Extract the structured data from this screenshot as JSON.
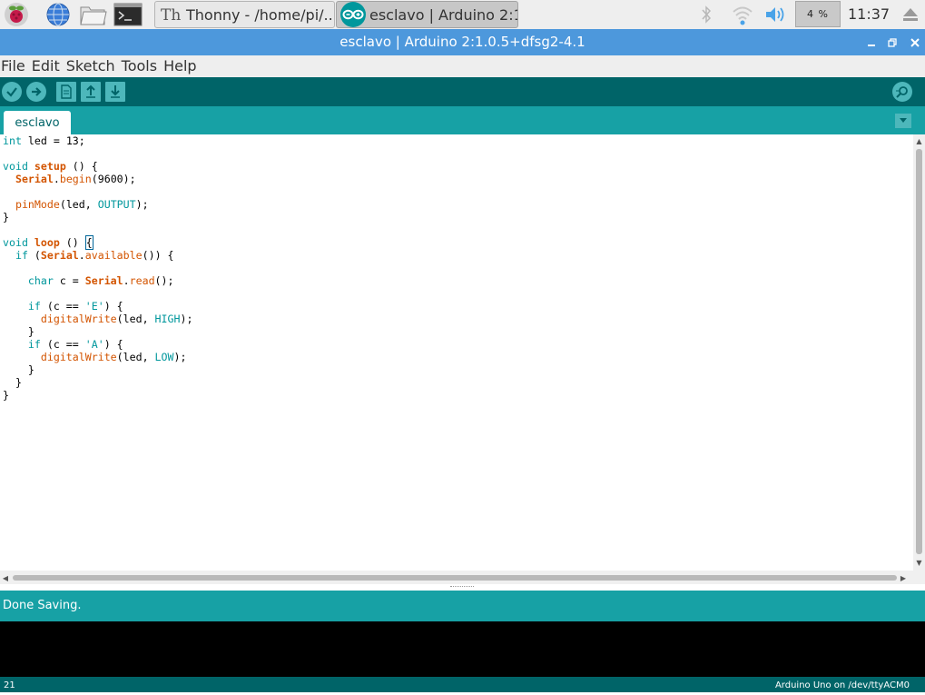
{
  "taskbar": {
    "launchers": [
      {
        "icon": "raspberry-menu-icon"
      },
      {
        "icon": "web-browser-icon"
      },
      {
        "icon": "file-manager-icon"
      },
      {
        "icon": "terminal-icon"
      }
    ],
    "tasks": [
      {
        "label": "Thonny  -  /home/pi/...",
        "icon": "thonny-icon",
        "active": false
      },
      {
        "label": "esclavo | Arduino 2:1....",
        "icon": "arduino-icon",
        "active": true
      }
    ],
    "tray": {
      "bluetooth_icon": "bluetooth-icon",
      "wifi_icon": "wifi-icon",
      "volume_icon": "volume-icon",
      "cpu_usage": "4 %",
      "clock": "11:37",
      "eject_icon": "eject-icon"
    }
  },
  "window": {
    "title": "esclavo | Arduino 2:1.0.5+dfsg2-4.1",
    "controls": [
      "minimize-icon",
      "maximize-icon",
      "close-icon"
    ]
  },
  "menu": [
    "File",
    "Edit",
    "Sketch",
    "Tools",
    "Help"
  ],
  "toolbar": {
    "buttons": [
      {
        "name": "verify-button",
        "icon": "check-icon"
      },
      {
        "name": "upload-button",
        "icon": "arrow-right-icon"
      },
      {
        "name": "new-button",
        "icon": "new-file-icon"
      },
      {
        "name": "open-button",
        "icon": "arrow-up-icon"
      },
      {
        "name": "save-button",
        "icon": "arrow-down-icon"
      }
    ],
    "serial_monitor_icon": "serial-monitor-icon"
  },
  "tabs": {
    "active": "esclavo"
  },
  "code": [
    "int led = 13;",
    "",
    "void setup () {",
    "  Serial.begin(9600);",
    "",
    "  pinMode(led, OUTPUT);",
    "}",
    "",
    "void loop () {",
    "  if (Serial.available()) {",
    "",
    "    char c = Serial.read();",
    "",
    "    if (c == 'E') {",
    "      digitalWrite(led, HIGH);",
    "    }",
    "    if (c == 'A') {",
    "      digitalWrite(led, LOW);",
    "    }",
    "  }",
    "}"
  ],
  "status": {
    "message": "Done Saving."
  },
  "footer": {
    "line": "21",
    "board": "Arduino Uno on /dev/ttyACM0"
  }
}
